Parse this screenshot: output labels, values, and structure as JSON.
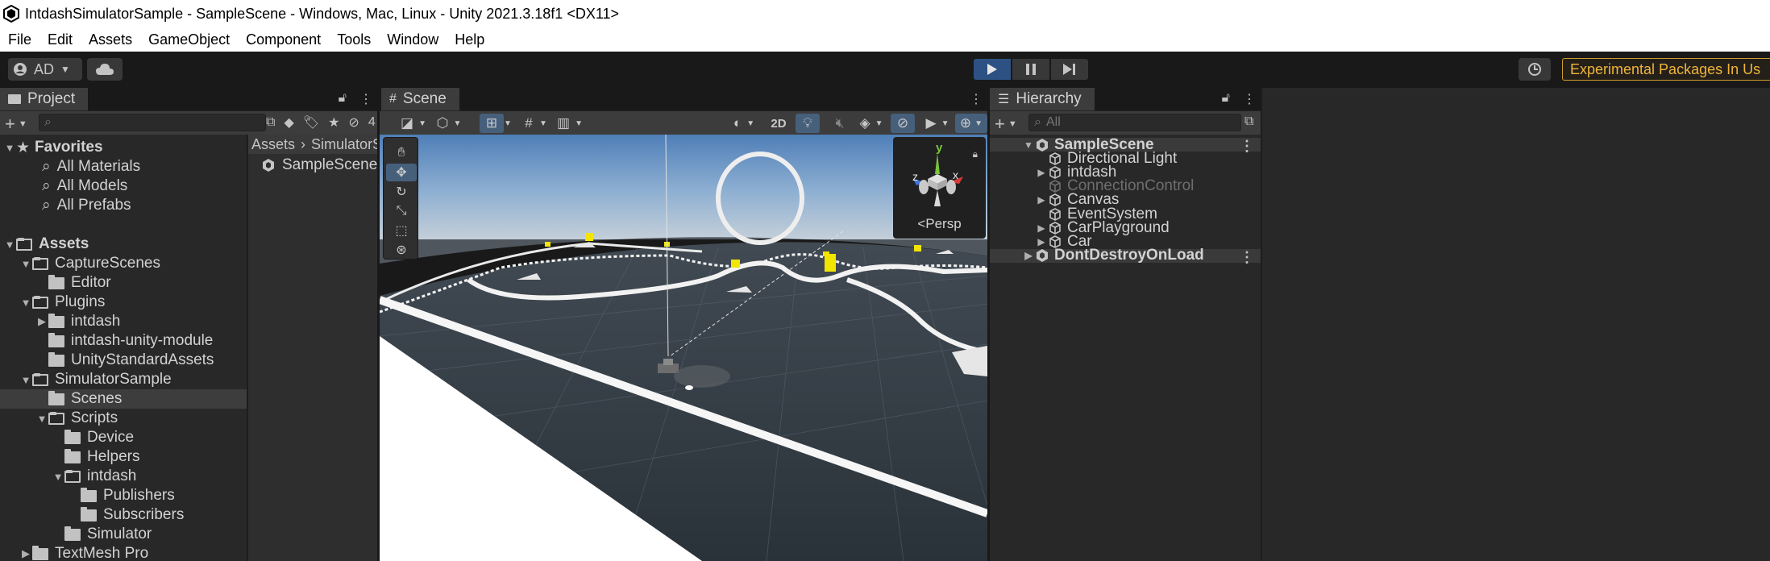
{
  "window": {
    "title": "IntdashSimulatorSample - SampleScene - Windows, Mac, Linux - Unity 2021.3.18f1 <DX11>"
  },
  "menu": [
    "File",
    "Edit",
    "Assets",
    "GameObject",
    "Component",
    "Tools",
    "Window",
    "Help"
  ],
  "toolbar": {
    "account_label": "AD",
    "experimental_label": "Experimental Packages In Us"
  },
  "project": {
    "tab_label": "Project",
    "hidden_count": "4",
    "tree": [
      {
        "label": "Favorites",
        "level": 0,
        "arrow": "open",
        "icon": "star",
        "bold": true
      },
      {
        "label": "All Materials",
        "level": 1,
        "arrow": "none",
        "icon": "search"
      },
      {
        "label": "All Models",
        "level": 1,
        "arrow": "none",
        "icon": "search"
      },
      {
        "label": "All Prefabs",
        "level": 1,
        "arrow": "none",
        "icon": "search"
      },
      {
        "label": "",
        "level": 0,
        "arrow": "spacer",
        "icon": "none"
      },
      {
        "label": "Assets",
        "level": 0,
        "arrow": "open",
        "icon": "folder-open",
        "bold": true
      },
      {
        "label": "CaptureScenes",
        "level": 1,
        "arrow": "open",
        "icon": "folder-open"
      },
      {
        "label": "Editor",
        "level": 2,
        "arrow": "none",
        "icon": "folder"
      },
      {
        "label": "Plugins",
        "level": 1,
        "arrow": "open",
        "icon": "folder-open"
      },
      {
        "label": "intdash",
        "level": 2,
        "arrow": "closed",
        "icon": "folder"
      },
      {
        "label": "intdash-unity-module",
        "level": 2,
        "arrow": "none",
        "icon": "folder"
      },
      {
        "label": "UnityStandardAssets",
        "level": 2,
        "arrow": "none",
        "icon": "folder"
      },
      {
        "label": "SimulatorSample",
        "level": 1,
        "arrow": "open",
        "icon": "folder-open"
      },
      {
        "label": "Scenes",
        "level": 2,
        "arrow": "none",
        "icon": "folder",
        "selected": true
      },
      {
        "label": "Scripts",
        "level": 2,
        "arrow": "open",
        "icon": "folder-open"
      },
      {
        "label": "Device",
        "level": 3,
        "arrow": "none",
        "icon": "folder"
      },
      {
        "label": "Helpers",
        "level": 3,
        "arrow": "none",
        "icon": "folder"
      },
      {
        "label": "intdash",
        "level": 3,
        "arrow": "open",
        "icon": "folder-open"
      },
      {
        "label": "Publishers",
        "level": 4,
        "arrow": "none",
        "icon": "folder"
      },
      {
        "label": "Subscribers",
        "level": 4,
        "arrow": "none",
        "icon": "folder"
      },
      {
        "label": "Simulator",
        "level": 3,
        "arrow": "none",
        "icon": "folder"
      },
      {
        "label": "TextMesh Pro",
        "level": 1,
        "arrow": "closed",
        "icon": "folder"
      }
    ],
    "breadcrumb": [
      "Assets",
      "SimulatorSample"
    ],
    "asset_item": "SampleScene"
  },
  "scene": {
    "tab_label": "Scene",
    "mode_2d": "2D",
    "persp_label": "Persp",
    "gizmo_axes": {
      "x": "x",
      "y": "y",
      "z": "z"
    }
  },
  "hierarchy": {
    "tab_label": "Hierarchy",
    "search_placeholder": "All",
    "rows": [
      {
        "label": "SampleScene",
        "level": 0,
        "arrow": "open",
        "icon": "unity",
        "header": true
      },
      {
        "label": "Directional Light",
        "level": 1,
        "arrow": "none",
        "icon": "cube"
      },
      {
        "label": "intdash",
        "level": 1,
        "arrow": "closed",
        "icon": "cube"
      },
      {
        "label": "ConnectionControl",
        "level": 1,
        "arrow": "none",
        "icon": "cube",
        "disabled": true
      },
      {
        "label": "Canvas",
        "level": 1,
        "arrow": "closed",
        "icon": "cube"
      },
      {
        "label": "EventSystem",
        "level": 1,
        "arrow": "none",
        "icon": "cube"
      },
      {
        "label": "CarPlayground",
        "level": 1,
        "arrow": "closed",
        "icon": "cube"
      },
      {
        "label": "Car",
        "level": 1,
        "arrow": "closed",
        "icon": "cube"
      },
      {
        "label": "DontDestroyOnLoad",
        "level": 0,
        "arrow": "closed",
        "icon": "unity",
        "header": true
      }
    ]
  },
  "colors": {
    "play_active": "#2e5183",
    "experimental_text": "#f0b43c",
    "gizmo_x": "#d93b3b",
    "gizmo_y": "#7ac43a",
    "gizmo_z": "#3a74e0"
  }
}
